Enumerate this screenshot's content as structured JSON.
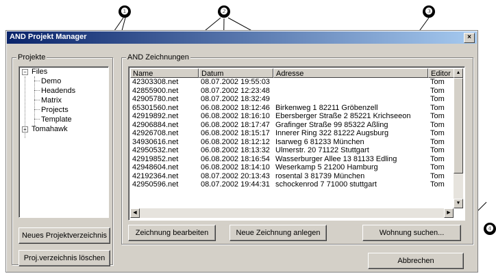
{
  "window": {
    "title": "AND Projekt Manager",
    "close": "×"
  },
  "projects": {
    "label": "Projekte",
    "tree": [
      {
        "label": "Files",
        "expander": "−"
      },
      {
        "label": "Demo"
      },
      {
        "label": "Headends"
      },
      {
        "label": "Matrix"
      },
      {
        "label": "Projects"
      },
      {
        "label": "Template"
      },
      {
        "label": "Tomahawk",
        "expander": "+"
      }
    ],
    "btn_new": "Neues Projektverzeichnis",
    "btn_delete": "Proj.verzeichnis löschen"
  },
  "drawings": {
    "label": "AND Zeichnungen",
    "columns": [
      "Name",
      "Datum",
      "Adresse",
      "Editor"
    ],
    "rows": [
      [
        "42303308.net",
        "08.07.2002 19:55:03",
        "",
        "Tom"
      ],
      [
        "42855900.net",
        "08.07.2002 12:23:48",
        "",
        "Tom"
      ],
      [
        "42905780.net",
        "08.07.2002 18:32:49",
        "",
        "Tom"
      ],
      [
        "65301560.net",
        "06.08.2002 18:12:46",
        "Birkenweg 1 82211 Gröbenzell",
        "Tom"
      ],
      [
        "42919892.net",
        "06.08.2002 18:16:10",
        "Ebersberger Straße 2 85221 Krichseeon",
        "Tom"
      ],
      [
        "42906884.net",
        "06.08.2002 18:17:47",
        "Grafinger Straße 99 85322 Aßling",
        "Tom"
      ],
      [
        "42926708.net",
        "06.08.2002 18:15:17",
        "Innerer Ring 322 81222 Augsburg",
        "Tom"
      ],
      [
        "34930616.net",
        "06.08.2002 18:12:12",
        "Isarweg 6 81233 München",
        "Tom"
      ],
      [
        "42950532.net",
        "06.08.2002 18:13:32",
        "Ulmerstr. 20 71122 Stuttgart",
        "Tom"
      ],
      [
        "42919852.net",
        "06.08.2002 18:16:54",
        "Wasserburger Allee 13 81133 Edling",
        "Tom"
      ],
      [
        "42948604.net",
        "06.08.2002 18:14:10",
        "Weserkamp 5 21200 Hamburg",
        "Tom"
      ],
      [
        "42192364.net",
        "08.07.2002 20:13:43",
        "rosental 3 81739 München",
        "Tom"
      ],
      [
        "42950596.net",
        "08.07.2002 19:44:31",
        "schockenrod 7 71000 stuttgart",
        "Tom"
      ]
    ],
    "btn_edit": "Zeichnung bearbeiten",
    "btn_new": "Neue Zeichnung anlegen",
    "btn_search": "Wohnung suchen...",
    "btn_cancel": "Abbrechen"
  },
  "callouts": [
    "❶",
    "❷",
    "❸",
    "❹"
  ]
}
